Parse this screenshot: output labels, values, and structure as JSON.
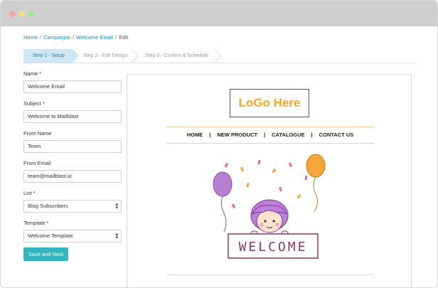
{
  "breadcrumb": {
    "home": "Home",
    "campaigns": "Campaigns",
    "campaign": "Welcome Email",
    "current": "Edit",
    "separator": "/"
  },
  "steps": [
    {
      "label": "Step 1 - Setup",
      "active": true
    },
    {
      "label": "Step 2 - Edit Design",
      "active": false
    },
    {
      "label": "Step 3 - Confirm & Schedule",
      "active": false
    }
  ],
  "form": {
    "name_label": "Name *",
    "name_value": "Welcome Email",
    "subject_label": "Subject *",
    "subject_value": "Welcome to Mailblast",
    "from_name_label": "From Name",
    "from_name_value": "Team",
    "from_email_label": "From Email",
    "from_email_value": "team@mailblast.io",
    "list_label": "List *",
    "list_value": "Blog Subscribers",
    "template_label": "Template *",
    "template_value": "Welcome Template",
    "submit_label": "Save and Next"
  },
  "preview": {
    "logo_text": "LoGo Here",
    "nav": [
      "HOME",
      "NEW PRODUCT",
      "CATALOGUE",
      "CONTACT US"
    ],
    "nav_separator": "|",
    "banner_text": "WELCOME"
  },
  "colors": {
    "accent": "#33b6bf",
    "link": "#1a8ec2",
    "step_active": "#cfe8f6",
    "logo": "#f5a623",
    "balloon_purple": "#b67fd0",
    "balloon_orange": "#f5a63a"
  }
}
